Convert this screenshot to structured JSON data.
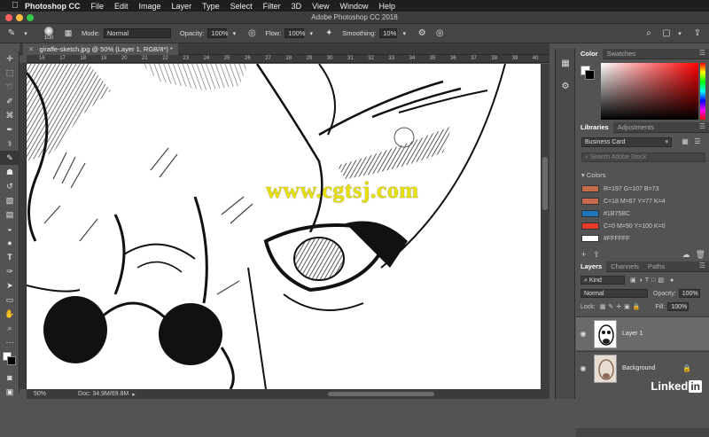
{
  "menubar": {
    "items": [
      "Photoshop CC",
      "File",
      "Edit",
      "Image",
      "Layer",
      "Type",
      "Select",
      "Filter",
      "3D",
      "View",
      "Window",
      "Help"
    ]
  },
  "window": {
    "title": "Adobe Photoshop CC 2018"
  },
  "options": {
    "brush_size": "100",
    "mode_label": "Mode:",
    "mode_value": "Normal",
    "opacity_label": "Opacity:",
    "opacity_value": "100%",
    "flow_label": "Flow:",
    "flow_value": "100%",
    "smoothing_label": "Smoothing:",
    "smoothing_value": "10%"
  },
  "document": {
    "tab_label": "giraffe-sketch.jpg @ 50% (Layer 1, RGB/8*) *",
    "ruler_labels": [
      "16",
      "17",
      "18",
      "19",
      "20",
      "21",
      "22",
      "23",
      "24",
      "25",
      "26",
      "27",
      "28",
      "29",
      "30",
      "31",
      "32",
      "33",
      "34",
      "35",
      "36",
      "37",
      "38",
      "39",
      "40"
    ],
    "zoom": "50%",
    "doc_info": "Doc: 34.9M/69.8M"
  },
  "watermark": "www.cgtsj.com",
  "color_panel": {
    "tabs": [
      "Color",
      "Swatches"
    ]
  },
  "libraries": {
    "tabs": [
      "Libraries",
      "Adjustments"
    ],
    "library": "Business Card",
    "search_placeholder": "Search Adobe Stock",
    "colors_header": "Colors",
    "colors": [
      {
        "label": "R=197 G=107 B=73",
        "hex": "#C56B49"
      },
      {
        "label": "C=18 M=67 Y=77 K=4",
        "hex": "#C9694E"
      },
      {
        "label": "#1B75BC",
        "hex": "#1B75BC"
      },
      {
        "label": "C=0 M=90 Y=100 K=0",
        "hex": "#E8392A"
      },
      {
        "label": "#FFFFFF",
        "hex": "#FFFFFF"
      }
    ]
  },
  "layers": {
    "tabs": [
      "Layers",
      "Channels",
      "Paths"
    ],
    "filter": "Kind",
    "blend": "Normal",
    "opacity_label": "Opacity:",
    "opacity_value": "100%",
    "lock_label": "Lock:",
    "fill_label": "Fill:",
    "fill_value": "100%",
    "items": [
      {
        "name": "Layer 1"
      },
      {
        "name": "Background"
      }
    ]
  },
  "branding": {
    "linkedin": "Linked",
    "in": "in"
  }
}
